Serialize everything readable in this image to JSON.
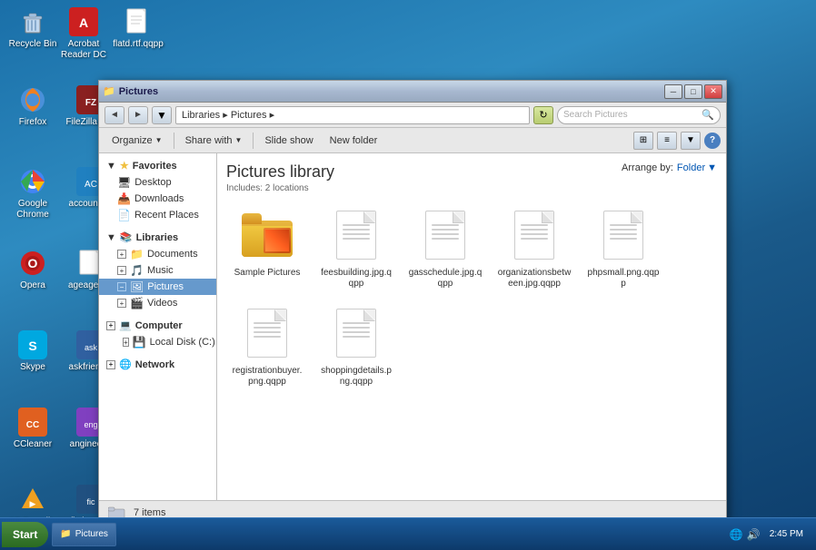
{
  "desktop": {
    "icons": [
      {
        "id": "recycle-bin",
        "label": "Recycle Bin",
        "type": "recycle"
      },
      {
        "id": "acrobat",
        "label": "Acrobat Reader DC",
        "type": "acrobat"
      },
      {
        "id": "flatd",
        "label": "flatd.rtf.qqpp",
        "type": "file"
      },
      {
        "id": "firefox",
        "label": "Firefox",
        "type": "firefox"
      },
      {
        "id": "filezilla",
        "label": "FileZilla Cl...",
        "type": "filezilla"
      },
      {
        "id": "chrome",
        "label": "Google Chrome",
        "type": "chrome"
      },
      {
        "id": "accounta",
        "label": "accounta...",
        "type": "app"
      },
      {
        "id": "opera",
        "label": "Opera",
        "type": "opera"
      },
      {
        "id": "ageage",
        "label": "ageage.p...",
        "type": "file"
      },
      {
        "id": "skype",
        "label": "Skype",
        "type": "skype"
      },
      {
        "id": "askfriend",
        "label": "askfriend...",
        "type": "app"
      },
      {
        "id": "ccleaner",
        "label": "CCleaner",
        "type": "ccleaner"
      },
      {
        "id": "angineer",
        "label": "angineer...",
        "type": "app"
      },
      {
        "id": "vlc",
        "label": "VLC media player",
        "type": "vlc"
      },
      {
        "id": "fictions",
        "label": "fictionsp...",
        "type": "app"
      }
    ]
  },
  "window": {
    "title": "Pictures",
    "title_icon": "📁",
    "minimize": "─",
    "maximize": "□",
    "close": "✕"
  },
  "address_bar": {
    "back_label": "◄",
    "forward_label": "►",
    "folder_label": "📁",
    "path": "Libraries ▸ Pictures ▸",
    "refresh_label": "↻",
    "search_placeholder": "Search Pictures"
  },
  "toolbar": {
    "organize_label": "Organize",
    "share_label": "Share with",
    "slideshow_label": "Slide show",
    "new_folder_label": "New folder"
  },
  "library": {
    "title": "Pictures library",
    "subtitle": "Includes: 2 locations",
    "arrange_label": "Arrange by:",
    "arrange_value": "Folder"
  },
  "sidebar": {
    "favorites_label": "Favorites",
    "desktop_label": "Desktop",
    "downloads_label": "Downloads",
    "recent_label": "Recent Places",
    "libraries_label": "Libraries",
    "documents_label": "Documents",
    "music_label": "Music",
    "pictures_label": "Pictures",
    "videos_label": "Videos",
    "computer_label": "Computer",
    "local_disk_label": "Local Disk (C:)",
    "network_label": "Network"
  },
  "files": [
    {
      "id": "sample-pictures",
      "name": "Sample Pictures",
      "type": "folder-thumb"
    },
    {
      "id": "feesbuilding",
      "name": "feesbuilding.jpg.qqpp",
      "type": "doc"
    },
    {
      "id": "gasschedule",
      "name": "gasschedule.jpg.qqpp",
      "type": "doc"
    },
    {
      "id": "organizationsbetween",
      "name": "organizationsbetween.jpg.qqpp",
      "type": "doc"
    },
    {
      "id": "phpsmall",
      "name": "phpsmall.png.qqpp",
      "type": "doc"
    },
    {
      "id": "registrationbuyer",
      "name": "registrationbuyer.png.qqpp",
      "type": "doc"
    },
    {
      "id": "shoppingdetails",
      "name": "shoppingdetails.png.qqpp",
      "type": "doc"
    }
  ],
  "status_bar": {
    "count": "7 items"
  },
  "taskbar": {
    "start_label": "Start",
    "task_label": "Pictures",
    "clock": "▲ ◀ 🔊\n2:45 PM"
  }
}
